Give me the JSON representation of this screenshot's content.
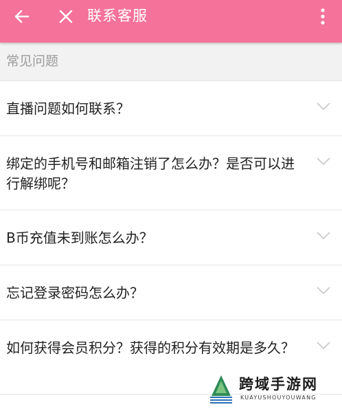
{
  "appbar": {
    "title": "联系客服",
    "icons": {
      "back": "arrow-left-icon",
      "close": "close-icon",
      "more": "more-vertical-icon"
    },
    "color": "#f5729a"
  },
  "section": {
    "header": "常见问题"
  },
  "faq": {
    "items": [
      {
        "question": "直播问题如何联系？"
      },
      {
        "question": "绑定的手机号和邮箱注销了怎么办？是否可以进行解绑呢？"
      },
      {
        "question": "B币充值未到账怎么办？"
      },
      {
        "question": "忘记登录密码怎么办？"
      },
      {
        "question": "如何获得会员积分？获得的积分有效期是多久？"
      }
    ]
  },
  "watermark": {
    "brand": "跨域手游网",
    "sub": "KUAYUSHOUYOUWANG"
  }
}
